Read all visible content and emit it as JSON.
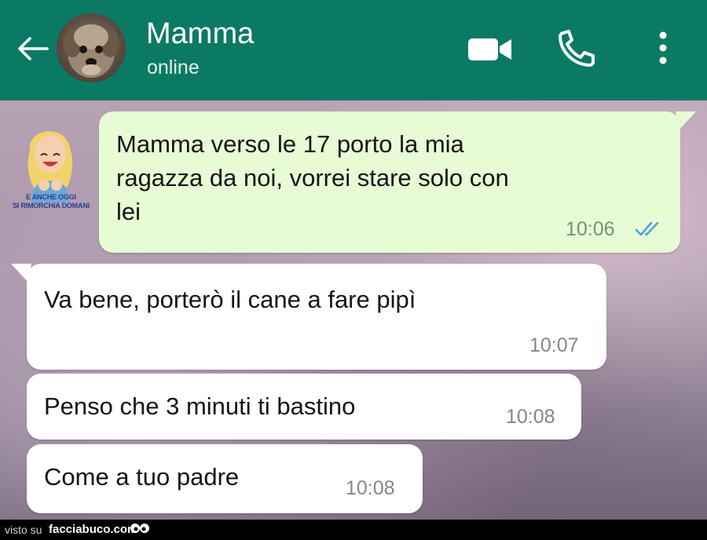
{
  "header": {
    "contact_name": "Mamma",
    "status": "online",
    "accent_color": "#0b7a64",
    "icons": [
      "back-arrow-icon",
      "avatar-photo",
      "video-call-icon",
      "phone-call-icon",
      "more-options-icon"
    ]
  },
  "sticker": {
    "caption_line1": "E ANCHE OGGI",
    "caption_line2": "SI RIMORCHIA DOMANI"
  },
  "messages": [
    {
      "direction": "outgoing",
      "lines": [
        "Mamma verso le 17  porto la mia",
        "ragazza da noi, vorrei stare solo con",
        "lei"
      ],
      "time": "10:06",
      "status_icon": "double-check-read-icon"
    },
    {
      "direction": "incoming",
      "text": "Va bene, porterò il cane a fare pipì",
      "time": "10:07"
    },
    {
      "direction": "incoming",
      "text": "Penso che 3 minuti ti bastino",
      "time": "10:08"
    },
    {
      "direction": "incoming",
      "text": "Come a tuo padre",
      "time": "10:08"
    }
  ],
  "colors": {
    "outgoing_bubble": "#e7fcd4",
    "incoming_bubble": "#ffffff",
    "read_ticks": "#4fa3e0"
  },
  "footer": {
    "prefix": "visto su",
    "site": "facciabuco.com"
  }
}
